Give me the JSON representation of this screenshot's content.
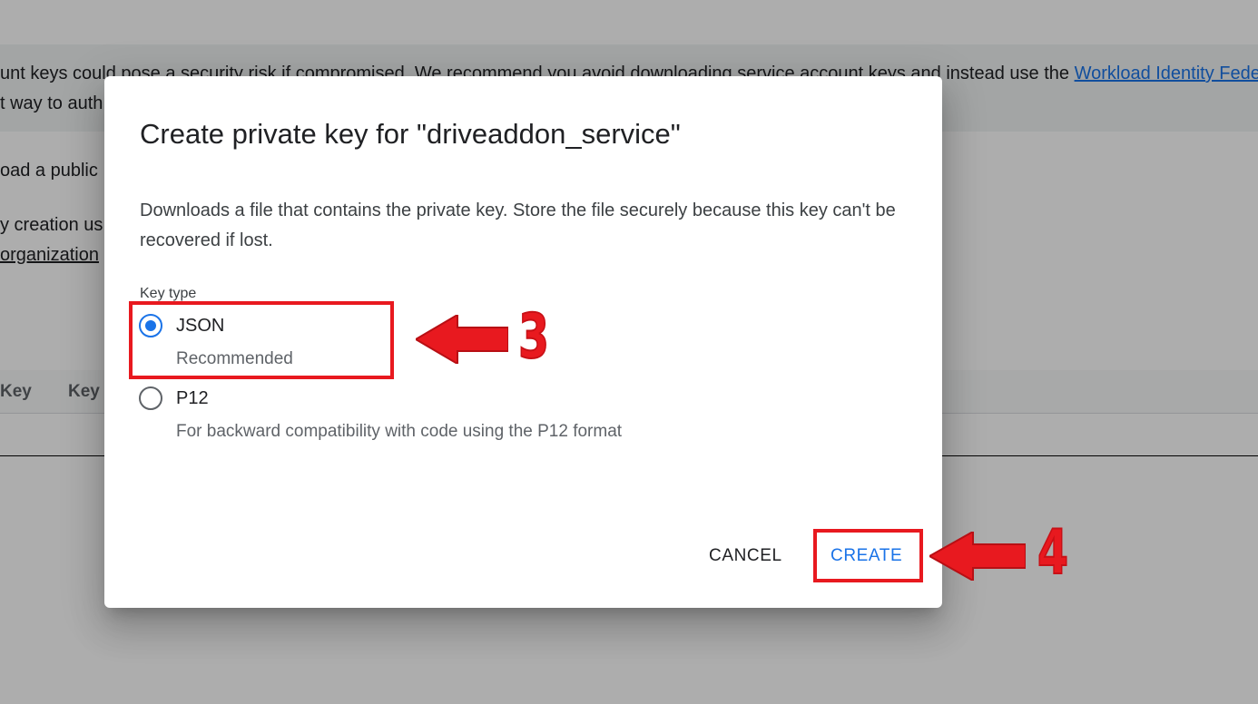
{
  "background": {
    "banner": {
      "line1_prefix": "unt keys could pose a security risk if compromised. We recommend you avoid downloading service account keys and instead use the ",
      "line1_link": "Workload Identity Federation",
      "line2": "t way to auth"
    },
    "text_lines": [
      "oad a public",
      "y creation us",
      "organization"
    ],
    "table": {
      "columns": [
        "Key",
        "Key c"
      ]
    }
  },
  "dialog": {
    "title": "Create private key for \"driveaddon_service\"",
    "description": "Downloads a file that contains the private key. Store the file securely because this key can't be recovered if lost.",
    "key_type_label": "Key type",
    "options": [
      {
        "label": "JSON",
        "sublabel": "Recommended",
        "checked": true
      },
      {
        "label": "P12",
        "sublabel": "For backward compatibility with code using the P12 format",
        "checked": false
      }
    ],
    "cancel_label": "CANCEL",
    "create_label": "CREATE"
  },
  "annotations": {
    "step_json": "3",
    "step_create": "4",
    "color": "#e8191f"
  },
  "colors": {
    "accent": "#1a73e8",
    "scrim": "rgba(0,0,0,0.32)"
  }
}
